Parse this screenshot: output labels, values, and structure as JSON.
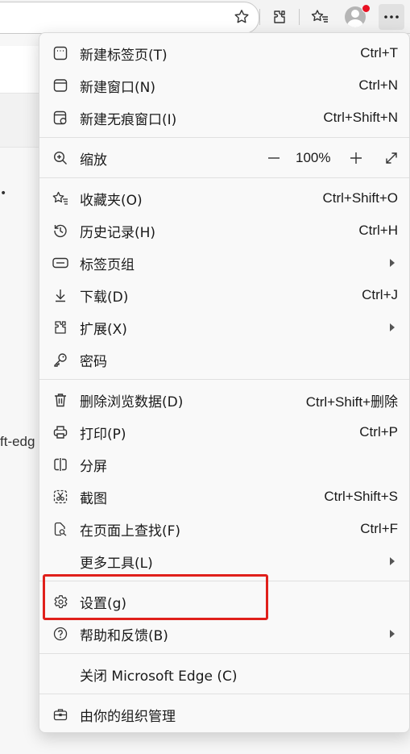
{
  "toolbar": {
    "icons": [
      "favorite-star-icon",
      "extensions-icon",
      "favorites-icon",
      "profile-avatar",
      "more-icon"
    ]
  },
  "page": {
    "visible_text": "ft-edg"
  },
  "menu": {
    "new_tab": {
      "label": "新建标签页(T)",
      "shortcut": "Ctrl+T"
    },
    "new_window": {
      "label": "新建窗口(N)",
      "shortcut": "Ctrl+N"
    },
    "new_inprivate": {
      "label": "新建无痕窗口(I)",
      "shortcut": "Ctrl+Shift+N"
    },
    "zoom": {
      "label": "缩放",
      "value": "100%"
    },
    "favorites": {
      "label": "收藏夹(O)",
      "shortcut": "Ctrl+Shift+O"
    },
    "history": {
      "label": "历史记录(H)",
      "shortcut": "Ctrl+H"
    },
    "tab_groups": {
      "label": "标签页组"
    },
    "downloads": {
      "label": "下载(D)",
      "shortcut": "Ctrl+J"
    },
    "extensions": {
      "label": "扩展(X)"
    },
    "passwords": {
      "label": "密码"
    },
    "clear_data": {
      "label": "删除浏览数据(D)",
      "shortcut": "Ctrl+Shift+删除"
    },
    "print": {
      "label": "打印(P)",
      "shortcut": "Ctrl+P"
    },
    "split_screen": {
      "label": "分屏"
    },
    "screenshot": {
      "label": "截图",
      "shortcut": "Ctrl+Shift+S"
    },
    "find": {
      "label": "在页面上查找(F)",
      "shortcut": "Ctrl+F"
    },
    "more_tools": {
      "label": "更多工具(L)"
    },
    "settings": {
      "label": "设置(g)"
    },
    "help": {
      "label": "帮助和反馈(B)"
    },
    "close_edge": {
      "label": "关闭 Microsoft Edge (C)"
    },
    "org_managed": {
      "label": "由你的组织管理"
    }
  },
  "colors": {
    "highlight_border": "#e0201b",
    "notification_dot": "#e81123"
  }
}
